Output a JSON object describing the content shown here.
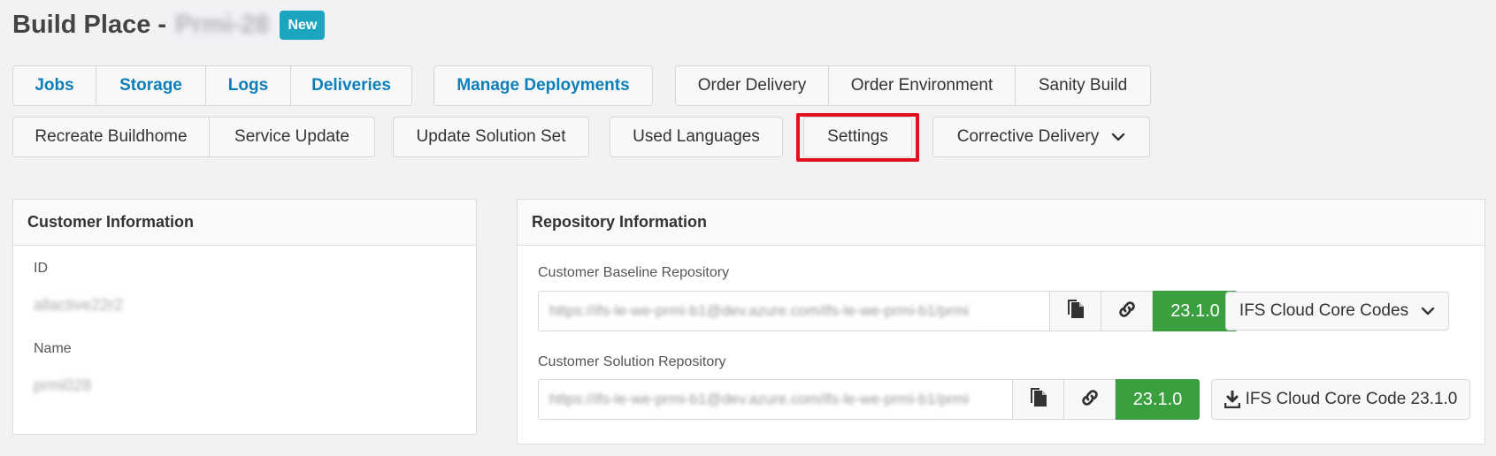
{
  "header": {
    "title": "Build Place -",
    "name": "Prmi-28",
    "badge": "New"
  },
  "toolbar": {
    "group1": [
      "Jobs",
      "Storage",
      "Logs",
      "Deliveries"
    ],
    "manage_deployments": "Manage Deployments",
    "group3": [
      "Order Delivery",
      "Order Environment",
      "Sanity Build"
    ],
    "group4": [
      "Recreate Buildhome",
      "Service Update"
    ],
    "update_solution_set": "Update Solution Set",
    "used_languages": "Used Languages",
    "settings": "Settings",
    "corrective_delivery": "Corrective Delivery"
  },
  "customer": {
    "heading": "Customer Information",
    "id_label": "ID",
    "id_value": "allactive22r2",
    "name_label": "Name",
    "name_value": "prmi028"
  },
  "repository": {
    "heading": "Repository Information",
    "baseline": {
      "label": "Customer Baseline Repository",
      "url": "https://ifs-le-we-prmi-b1@dev.azure.com/ifs-le-we-prmi-b1/prmi",
      "version": "23.1.0",
      "dropdown": "IFS Cloud Core Codes"
    },
    "solution": {
      "label": "Customer Solution Repository",
      "url": "https://ifs-le-we-prmi-b1@dev.azure.com/ifs-le-we-prmi-b1/prmi",
      "version": "23.1.0",
      "download": "IFS Cloud Core Code 23.1.0"
    }
  },
  "icons": [
    "copy-icon",
    "link-icon",
    "chevron-down-icon",
    "download-icon"
  ],
  "colors": {
    "primary_link": "#0c7fb8",
    "badge": "#1ba5bf",
    "version": "#3aa03f",
    "highlight": "#e1101b"
  }
}
